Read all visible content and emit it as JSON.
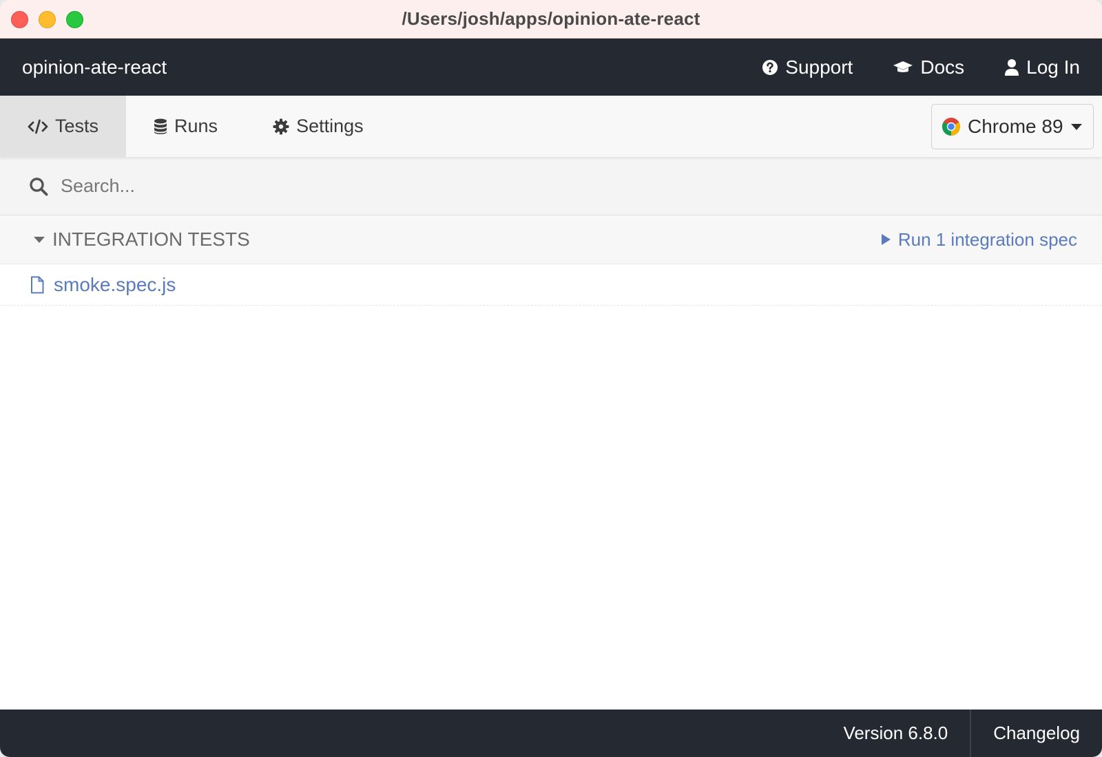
{
  "window": {
    "title": "/Users/josh/apps/opinion-ate-react"
  },
  "header": {
    "project_name": "opinion-ate-react",
    "links": [
      {
        "label": "Support",
        "icon": "question-circle-icon"
      },
      {
        "label": "Docs",
        "icon": "graduation-cap-icon"
      },
      {
        "label": "Log In",
        "icon": "user-icon"
      }
    ]
  },
  "tabs": [
    {
      "label": "Tests",
      "icon": "code-icon",
      "active": true
    },
    {
      "label": "Runs",
      "icon": "database-icon",
      "active": false
    },
    {
      "label": "Settings",
      "icon": "gear-icon",
      "active": false
    }
  ],
  "browser": {
    "label": "Chrome 89",
    "icon": "chrome-icon"
  },
  "search": {
    "placeholder": "Search...",
    "value": ""
  },
  "specs": {
    "group_title": "INTEGRATION TESTS",
    "run_label": "Run 1 integration spec",
    "files": [
      {
        "name": "smoke.spec.js"
      }
    ]
  },
  "footer": {
    "version": "Version 6.8.0",
    "changelog": "Changelog"
  },
  "colors": {
    "header_bg": "#252932",
    "link_blue": "#5a7bbd",
    "titlebar_bg": "#fcefee"
  }
}
